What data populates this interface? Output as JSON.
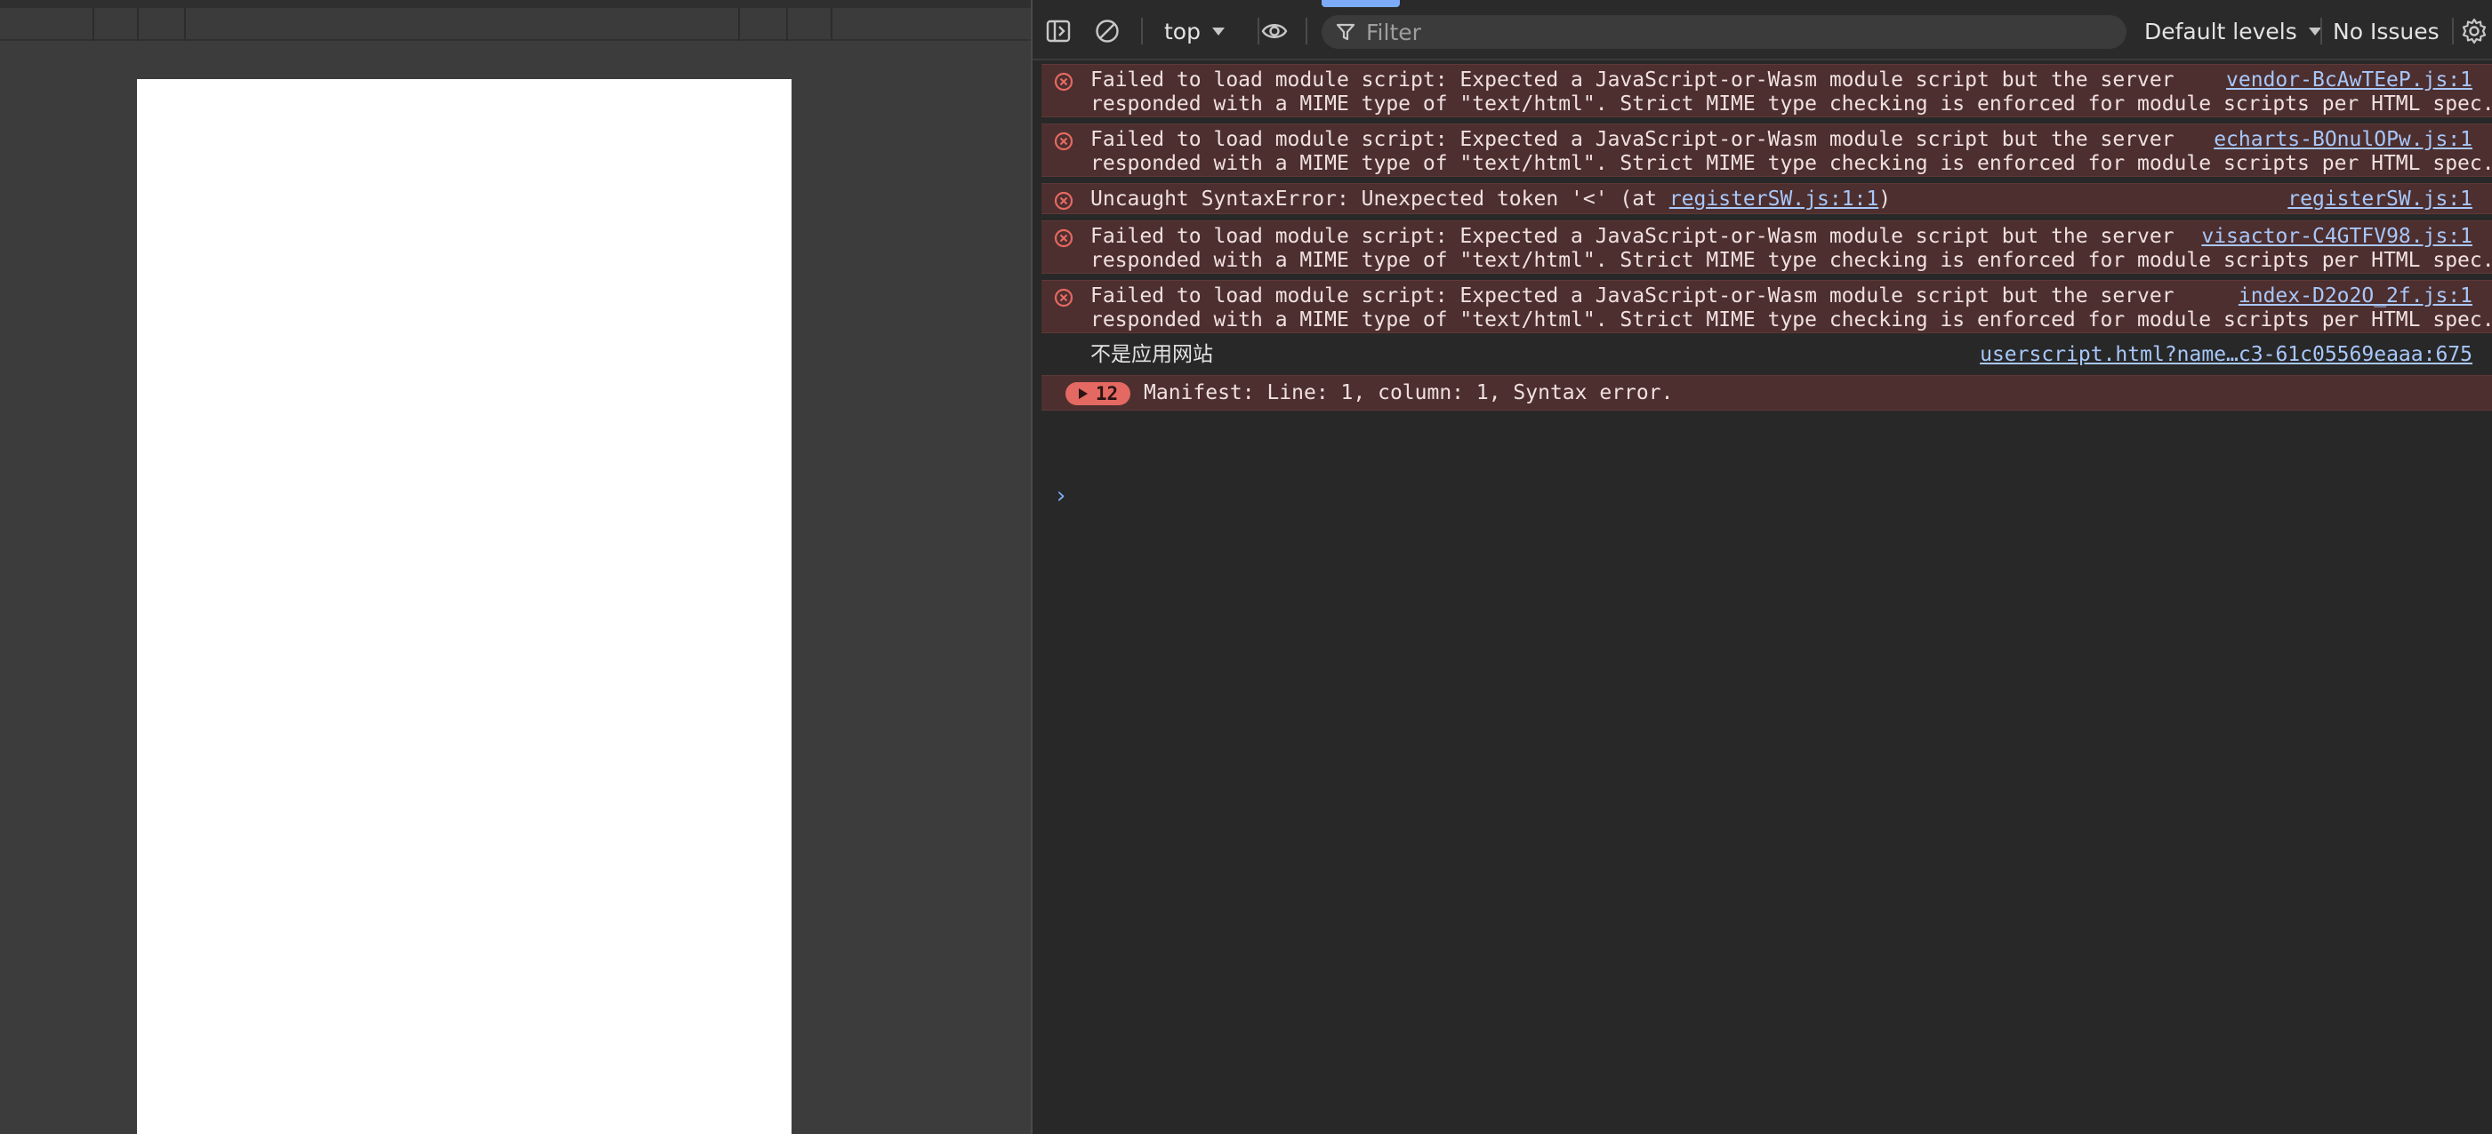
{
  "toolbar": {
    "context": "top",
    "filter_placeholder": "Filter",
    "levels": "Default levels",
    "issues": "No Issues",
    "icons": [
      "sidebar-toggle-icon",
      "clear-console-icon",
      "eye-icon",
      "filter-icon",
      "settings-gear-icon"
    ]
  },
  "messages": [
    {
      "level": "error",
      "line1": "Failed to load module script: Expected a JavaScript-or-Wasm module script but the server",
      "line2": "responded with a MIME type of \"text/html\". Strict MIME type checking is enforced for module scripts per HTML spec.",
      "source": "vendor-BcAwTEeP.js:1"
    },
    {
      "level": "error",
      "line1": "Failed to load module script: Expected a JavaScript-or-Wasm module script but the server",
      "line2": "responded with a MIME type of \"text/html\". Strict MIME type checking is enforced for module scripts per HTML spec.",
      "source": "echarts-BOnulOPw.js:1"
    },
    {
      "level": "error",
      "text_before": "Uncaught SyntaxError: Unexpected token '<' (at ",
      "inline_link": "registerSW.js:1:1",
      "text_after": ")",
      "source": "registerSW.js:1"
    },
    {
      "level": "error",
      "line1": "Failed to load module script: Expected a JavaScript-or-Wasm module script but the server",
      "line2": "responded with a MIME type of \"text/html\". Strict MIME type checking is enforced for module scripts per HTML spec.",
      "source": "visactor-C4GTFV98.js:1"
    },
    {
      "level": "error",
      "line1": "Failed to load module script: Expected a JavaScript-or-Wasm module script but the server",
      "line2": "responded with a MIME type of \"text/html\". Strict MIME type checking is enforced for module scripts per HTML spec.",
      "source": "index-D2o2O_2f.js:1"
    },
    {
      "level": "info",
      "text": "不是应用网站",
      "source": "userscript.html?name…c3-61c05569eaaa:675"
    },
    {
      "level": "error",
      "count": "12",
      "text": "Manifest: Line: 1, column: 1, Syntax error."
    }
  ],
  "prompt": "›",
  "colors": {
    "error_bg": "#4d2f2f",
    "error_icon": "#e46962",
    "link": "#a8c7fa",
    "accent": "#7cacf8"
  }
}
